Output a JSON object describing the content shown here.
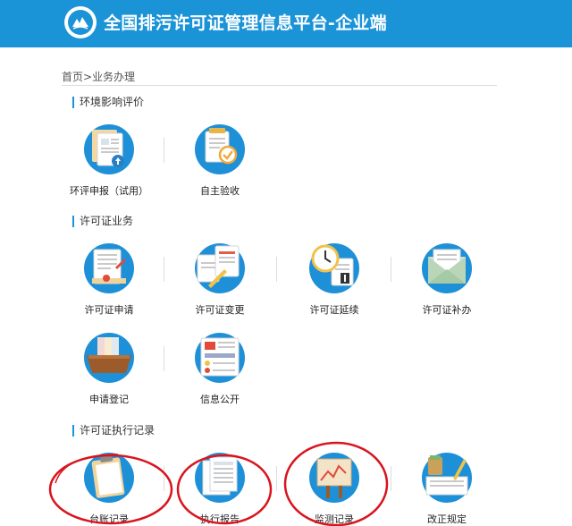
{
  "header": {
    "title": "全国排污许可证管理信息平台-企业端",
    "logo_icon": "ministry-seal-icon"
  },
  "breadcrumb": "首页>业务办理",
  "colors": {
    "header": "#1a93d7",
    "icon_circle": "#1e90d8",
    "highlight_ring": "#d9141e"
  },
  "sections": [
    {
      "title": "环境影响评价",
      "items": [
        {
          "label": "环评申报（试用）",
          "icon": "document-upload-icon"
        },
        {
          "label": "自主验收",
          "icon": "checklist-approve-icon"
        }
      ]
    },
    {
      "title": "许可证业务",
      "items": [
        {
          "label": "许可证申请",
          "icon": "application-form-icon"
        },
        {
          "label": "许可证变更",
          "icon": "edit-documents-icon"
        },
        {
          "label": "许可证延续",
          "icon": "clock-document-icon"
        },
        {
          "label": "许可证补办",
          "icon": "envelope-icon"
        },
        {
          "label": "申请登记",
          "icon": "file-folders-icon"
        },
        {
          "label": "信息公开",
          "icon": "information-board-icon"
        }
      ]
    },
    {
      "title": "许可证执行记录",
      "items": [
        {
          "label": "台账记录",
          "icon": "clipboard-icon"
        },
        {
          "label": "执行报告",
          "icon": "report-sheets-icon"
        },
        {
          "label": "监测记录",
          "icon": "monitoring-chart-icon"
        },
        {
          "label": "改正规定",
          "icon": "correction-notes-icon"
        }
      ]
    }
  ]
}
